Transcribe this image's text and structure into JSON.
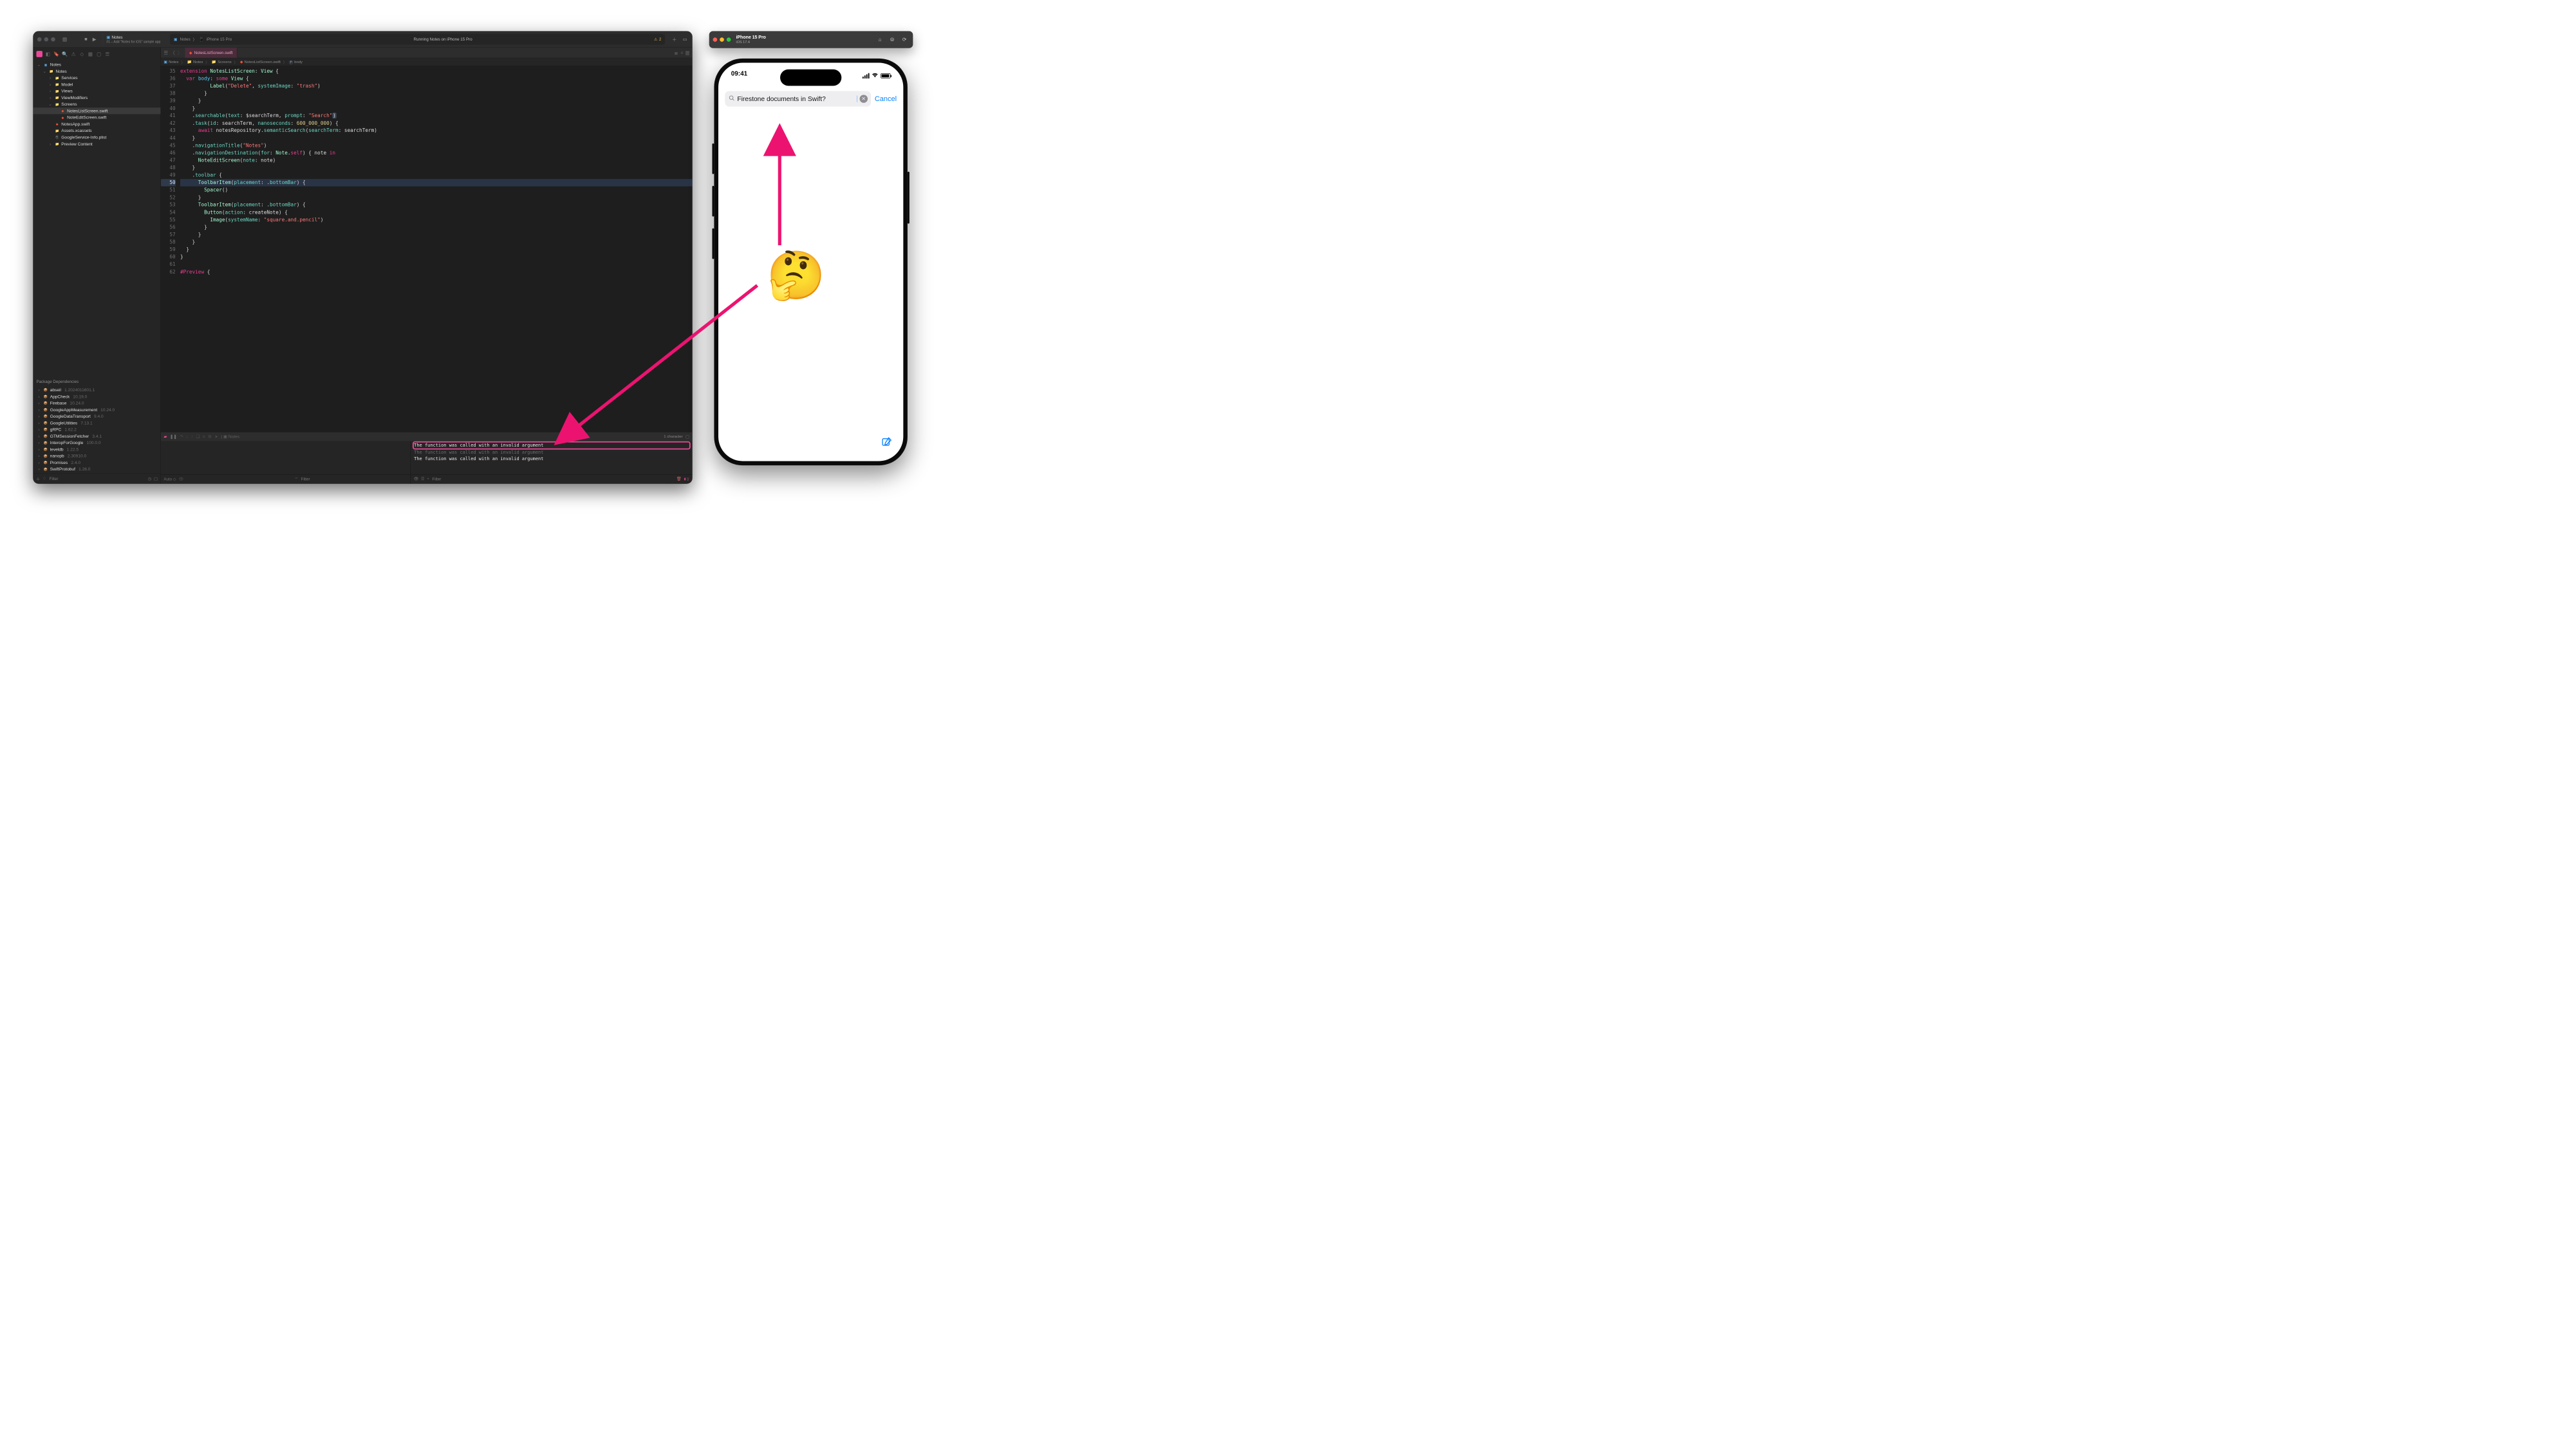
{
  "overlay": {
    "emoji": "🤔"
  },
  "xcode": {
    "toolbar": {
      "project": "Notes",
      "subtitle": "#1 – Add \"Notes for iOS\" sample app",
      "target_app": "Notes",
      "target_device": "iPhone 15 Pro",
      "status": "Running Notes on iPhone 15 Pro",
      "warnings": "2"
    },
    "navigator": {
      "filter_placeholder": "Filter",
      "tree": [
        {
          "indent": 0,
          "chev": "⌄",
          "icon": "app",
          "label": "Notes"
        },
        {
          "indent": 1,
          "chev": "⌄",
          "icon": "folder",
          "label": "Notes"
        },
        {
          "indent": 2,
          "chev": "›",
          "icon": "folder",
          "label": "Services"
        },
        {
          "indent": 2,
          "chev": "›",
          "icon": "folder",
          "label": "Model"
        },
        {
          "indent": 2,
          "chev": "›",
          "icon": "folder",
          "label": "Views"
        },
        {
          "indent": 2,
          "chev": "›",
          "icon": "folder",
          "label": "ViewModifiers"
        },
        {
          "indent": 2,
          "chev": "⌄",
          "icon": "folder",
          "label": "Screens"
        },
        {
          "indent": 3,
          "chev": "",
          "icon": "swift",
          "label": "NotesListScreen.swift",
          "selected": true
        },
        {
          "indent": 3,
          "chev": "",
          "icon": "swift",
          "label": "NoteEditScreen.swift"
        },
        {
          "indent": 2,
          "chev": "",
          "icon": "swift",
          "label": "NotesApp.swift"
        },
        {
          "indent": 2,
          "chev": "",
          "icon": "folder",
          "label": "Assets.xcassets"
        },
        {
          "indent": 2,
          "chev": "",
          "icon": "plist",
          "label": "GoogleService-Info.plist"
        },
        {
          "indent": 2,
          "chev": "›",
          "icon": "folder",
          "label": "Preview Content"
        }
      ],
      "deps_header": "Package Dependencies",
      "deps": [
        {
          "name": "abseil",
          "ver": "1.2024011601.1"
        },
        {
          "name": "AppCheck",
          "ver": "10.19.0"
        },
        {
          "name": "Firebase",
          "ver": "10.24.0"
        },
        {
          "name": "GoogleAppMeasurement",
          "ver": "10.24.0"
        },
        {
          "name": "GoogleDataTransport",
          "ver": "9.4.0"
        },
        {
          "name": "GoogleUtilities",
          "ver": "7.13.1"
        },
        {
          "name": "gRPC",
          "ver": "1.62.2"
        },
        {
          "name": "GTMSessionFetcher",
          "ver": "3.4.1"
        },
        {
          "name": "InteropForGoogle",
          "ver": "100.0.0"
        },
        {
          "name": "leveldb",
          "ver": "1.22.5"
        },
        {
          "name": "nanopb",
          "ver": "2.30910.0"
        },
        {
          "name": "Promises",
          "ver": "2.4.0"
        },
        {
          "name": "SwiftProtobuf",
          "ver": "1.26.0"
        }
      ]
    },
    "tabs": {
      "active": "NotesListScreen.swift"
    },
    "jumpbar": [
      "Notes",
      "Notes",
      "Screens",
      "NotesListScreen.swift",
      "body"
    ],
    "code": {
      "start": 35,
      "highlight": 50,
      "lines": [
        "<span class='k-pink'>extension</span> <span class='k-type'>NotesListScreen</span>: <span class='k-type'>View</span> {",
        "  <span class='k-pink'>var</span> <span class='k-cyan'>body</span>: <span class='k-pink'>some</span> <span class='k-type'>View</span> {",
        "          <span class='k-type'>Label</span>(<span class='k-str'>\"Delete\"</span>, <span class='k-param'>systemImage</span>: <span class='k-str'>\"trash\"</span>)",
        "        }",
        "      }",
        "    }",
        "    .<span class='k-func'>searchable</span>(<span class='k-param'>text</span>: <span class='k-ident'>$searchTerm</span>, <span class='k-param'>prompt</span>: <span class='k-str'>\"Search\"</span><span class='selbox'>)</span>",
        "    .<span class='k-func'>task</span>(<span class='k-param'>id</span>: <span class='k-ident'>searchTerm</span>, <span class='k-param'>nanoseconds</span>: <span class='k-num'>600_000_000</span>) {",
        "      <span class='k-pink'>await</span> <span class='k-ident'>notesRepository</span>.<span class='k-func'>semanticSearch</span>(<span class='k-param'>searchTerm</span>: <span class='k-ident'>searchTerm</span>)",
        "    }",
        "    .<span class='k-func'>navigationTitle</span>(<span class='k-str'>\"Notes\"</span>)",
        "    .<span class='k-func'>navigationDestination</span>(<span class='k-param'>for</span>: <span class='k-type'>Note</span>.<span class='k-pink'>self</span>) { <span class='k-ident'>note</span> <span class='k-pink'>in</span>",
        "      <span class='k-type'>NoteEditScreen</span>(<span class='k-param'>note</span>: <span class='k-ident'>note</span>)",
        "    }",
        "    .<span class='k-func'>toolbar</span> {",
        "      <span class='k-type'>ToolbarItem</span>(<span class='k-param'>placement</span>: .<span class='k-func'>bottomBar</span>) {",
        "        <span class='k-type'>Spacer</span>()",
        "      }",
        "      <span class='k-type'>ToolbarItem</span>(<span class='k-param'>placement</span>: .<span class='k-func'>bottomBar</span>) {",
        "        <span class='k-type'>Button</span>(<span class='k-param'>action</span>: <span class='k-ident'>createNote</span>) {",
        "          <span class='k-type'>Image</span>(<span class='k-param'>systemName</span>: <span class='k-str'>\"square.and.pencil\"</span>)",
        "        }",
        "      }",
        "    }",
        "  }",
        "}",
        "",
        "<span class='k-pink'>#Preview</span> {"
      ]
    },
    "debug": {
      "process": "Notes",
      "sel_info": "1 character",
      "console": [
        "The function was called with an invalid argument",
        "The function was called with an invalid argument",
        "The function was called with an invalid argument"
      ],
      "auto_label": "Auto ◇",
      "vars_filter_placeholder": "Filter",
      "console_filter_placeholder": "Filter"
    }
  },
  "simulator": {
    "title": "iPhone 15 Pro",
    "subtitle": "iOS 17.4",
    "time": "09:41",
    "search_value": "Firestone documents in Swift?",
    "cancel": "Cancel"
  }
}
